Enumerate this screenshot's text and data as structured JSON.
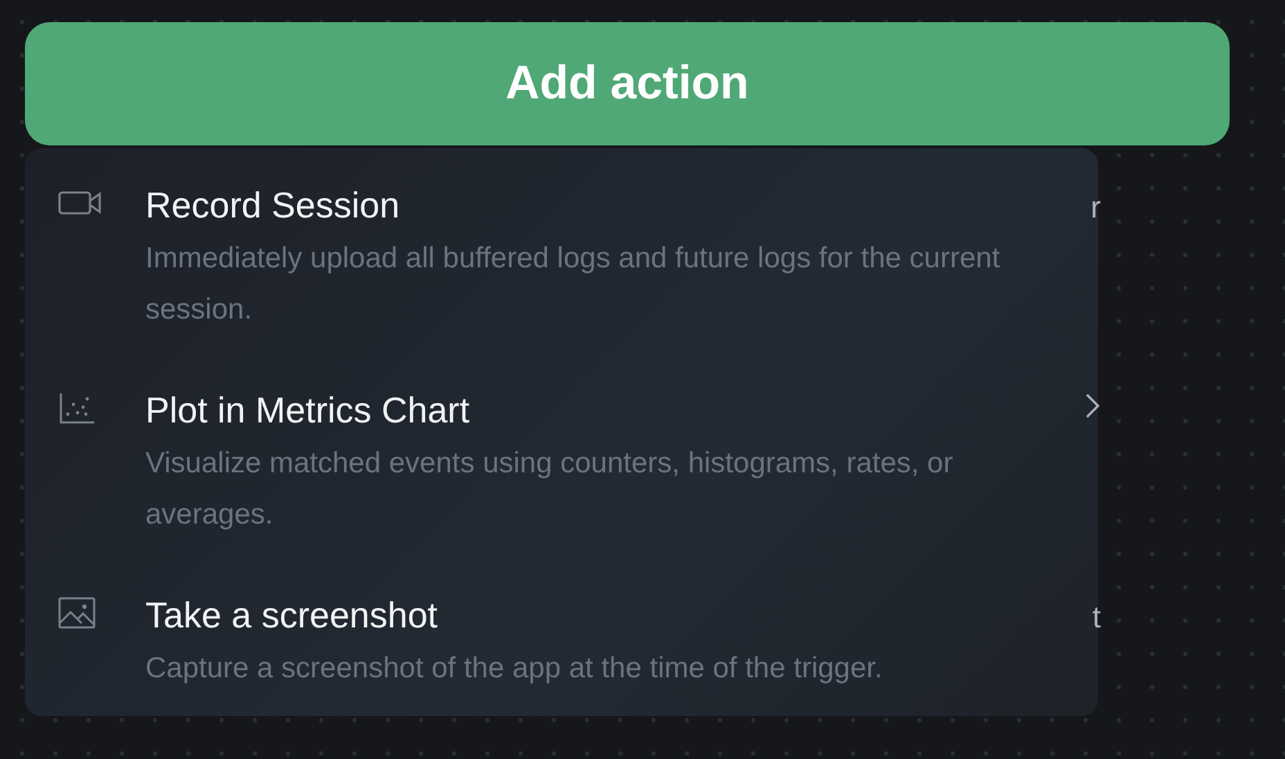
{
  "button": {
    "label": "Add action"
  },
  "actions": [
    {
      "title": "Record Session",
      "description": "Immediately upload all buffered logs and future logs for the current session.",
      "kind": "shortcut",
      "shortcut": "r"
    },
    {
      "title": "Plot in Metrics Chart",
      "description": "Visualize matched events using counters, histograms, rates, or averages.",
      "kind": "submenu"
    },
    {
      "title": "Take a screenshot",
      "description": "Capture a screenshot of the app at the time of the trigger.",
      "kind": "shortcut",
      "shortcut": "t"
    }
  ]
}
